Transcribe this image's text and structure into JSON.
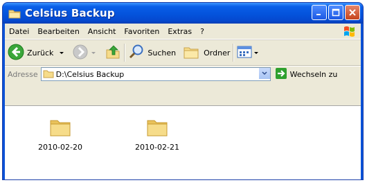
{
  "window": {
    "title": "Celsius Backup"
  },
  "menu": {
    "items": [
      "Datei",
      "Bearbeiten",
      "Ansicht",
      "Favoriten",
      "Extras",
      "?"
    ]
  },
  "toolbar": {
    "back_label": "Zurück",
    "search_label": "Suchen",
    "folders_label": "Ordner"
  },
  "address": {
    "label": "Adresse",
    "path": "D:\\Celsius Backup",
    "go_label": "Wechseln zu"
  },
  "files": [
    {
      "name": "2010-02-20",
      "icon": "folder-icon"
    },
    {
      "name": "2010-02-21",
      "icon": "folder-icon"
    }
  ],
  "colors": {
    "titlebar": "#0453dc",
    "client": "#ece9d8",
    "folder": "#f6dc8a",
    "go_arrow": "#2ea02e"
  }
}
